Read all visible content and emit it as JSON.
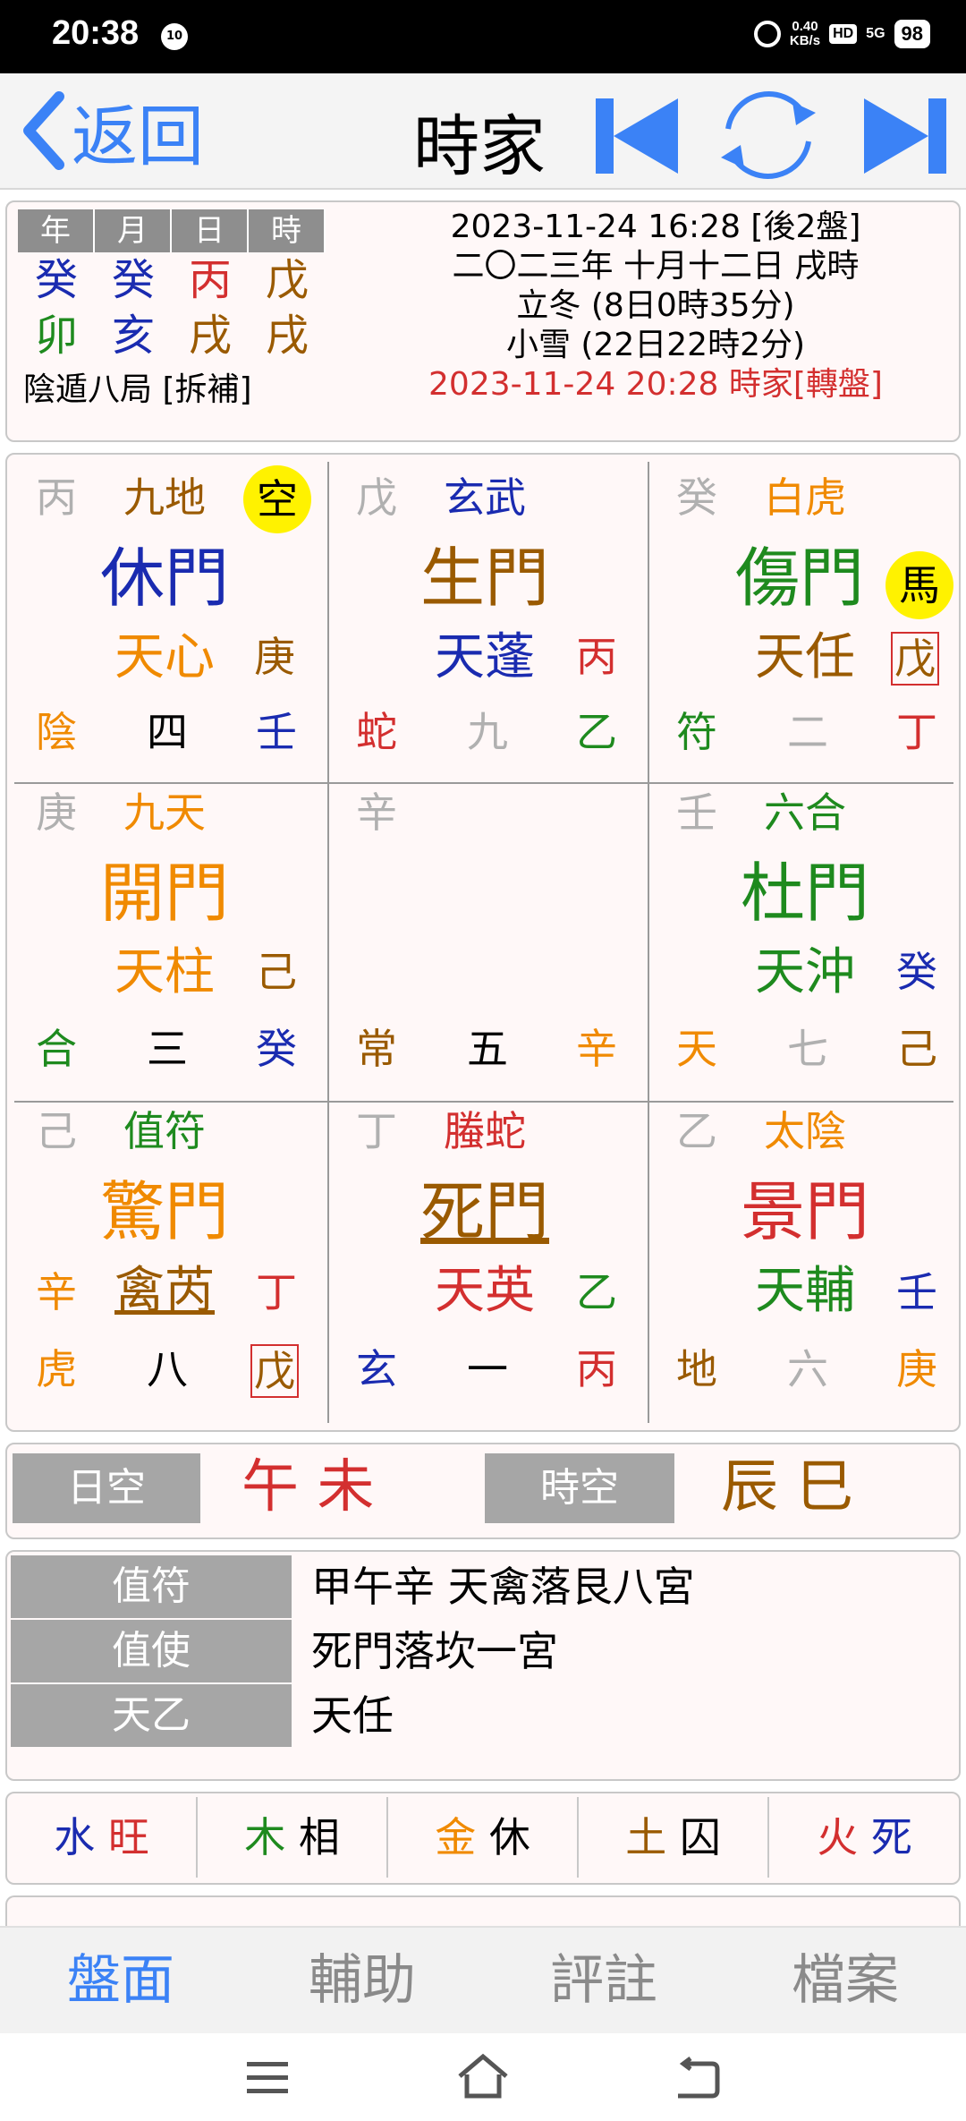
{
  "status": {
    "time": "20:38",
    "notif": "10",
    "net_speed_top": "0.40",
    "net_speed_bottom": "KB/s",
    "hd": "HD",
    "signal": "5G",
    "battery": "98"
  },
  "nav": {
    "back_label": "返回",
    "title": "時家"
  },
  "info": {
    "headers": [
      "年",
      "月",
      "日",
      "時"
    ],
    "stems": [
      "癸",
      "癸",
      "丙",
      "戊"
    ],
    "branches": [
      "卯",
      "亥",
      "戌",
      "戌"
    ],
    "ju": "陰遁八局 [拆補]",
    "line1": "2023-11-24 16:28  [後2盤]",
    "line2": "二〇二三年 十月十二日 戌時",
    "line3": "立冬 (8日0時35分)",
    "line4": "小雪 (22日22時2分)",
    "line5": "2023-11-24 20:28 時家[轉盤]"
  },
  "palaces": [
    {
      "tian_stem": "丙",
      "deity": "九地",
      "badge": "空",
      "door": "休門",
      "star": "天心",
      "star_stem": "庚",
      "god": "陰",
      "num": "四",
      "earth": "壬"
    },
    {
      "tian_stem": "戊",
      "deity": "玄武",
      "door": "生門",
      "star": "天蓬",
      "star_stem": "丙",
      "god": "蛇",
      "num": "九",
      "earth": "乙"
    },
    {
      "tian_stem": "癸",
      "deity": "白虎",
      "badge": "馬",
      "door": "傷門",
      "star": "天任",
      "star_stem": "戊",
      "god": "符",
      "num": "二",
      "earth": "丁"
    },
    {
      "tian_stem": "庚",
      "deity": "九天",
      "door": "開門",
      "star": "天柱",
      "star_stem": "己",
      "god": "合",
      "num": "三",
      "earth": "癸"
    },
    {
      "tian_stem": "辛",
      "god": "常",
      "num": "五",
      "earth": "辛"
    },
    {
      "tian_stem": "壬",
      "deity": "六合",
      "door": "杜門",
      "star": "天沖",
      "star_stem": "癸",
      "god": "天",
      "num": "七",
      "earth": "己"
    },
    {
      "tian_stem": "己",
      "deity": "值符",
      "door": "驚門",
      "star": "禽芮",
      "star_stem": "丁",
      "star_pre": "辛",
      "god": "虎",
      "num": "八",
      "earth": "戊"
    },
    {
      "tian_stem": "丁",
      "deity": "螣蛇",
      "door": "死門",
      "star": "天英",
      "star_stem": "乙",
      "god": "玄",
      "num": "一",
      "earth": "丙"
    },
    {
      "tian_stem": "乙",
      "deity": "太陰",
      "door": "景門",
      "star": "天輔",
      "star_stem": "壬",
      "god": "地",
      "num": "六",
      "earth": "庚"
    }
  ],
  "kong": {
    "day_label": "日空",
    "day_values": "午  未",
    "hour_label": "時空",
    "hour_values": "辰  巳"
  },
  "zhifu": [
    {
      "label": "值符",
      "value": "甲午辛  天禽落艮八宮"
    },
    {
      "label": "值使",
      "value": "死門落坎一宮"
    },
    {
      "label": "天乙",
      "value": "天任"
    }
  ],
  "elements": [
    {
      "el": "水",
      "state": "旺"
    },
    {
      "el": "木",
      "state": "相"
    },
    {
      "el": "金",
      "state": "休"
    },
    {
      "el": "土",
      "state": "囚"
    },
    {
      "el": "火",
      "state": "死"
    }
  ],
  "tabs": [
    "盤面",
    "輔助",
    "評註",
    "檔案"
  ],
  "colors": {
    "accent": "#3b82f6",
    "red": "#d32f2f",
    "blue": "#1a2bb0",
    "green": "#1e8a1e",
    "orange": "#f08a00",
    "brown": "#9a5a00",
    "gray": "#b0b0b0",
    "badge": "#fff200"
  }
}
